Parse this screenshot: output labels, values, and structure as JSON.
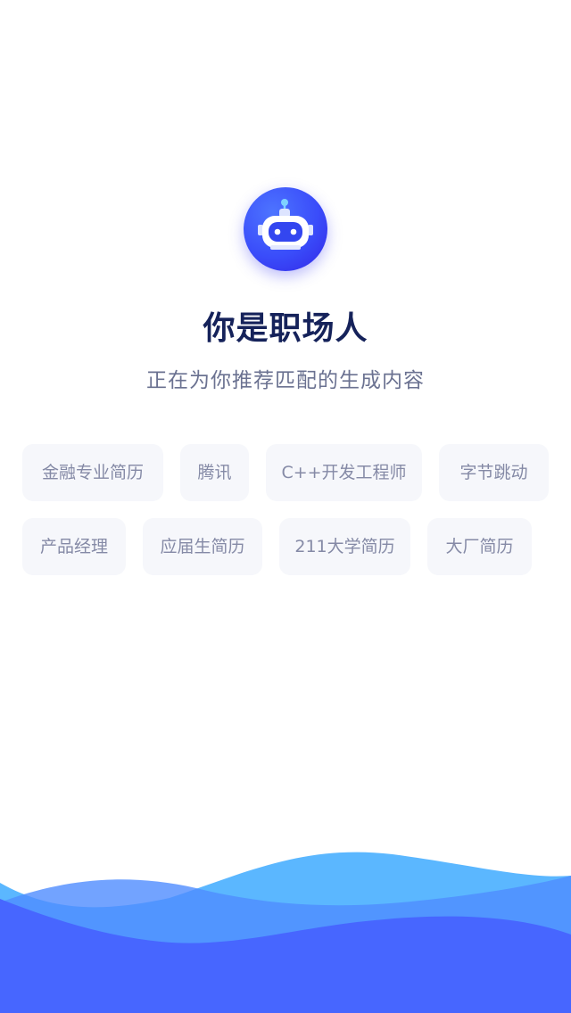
{
  "header": {
    "title": "你是职场人",
    "subtitle": "正在为你推荐匹配的生成内容"
  },
  "avatar": {
    "icon": "robot-icon"
  },
  "tags": {
    "row1": [
      "金融专业简历",
      "腾讯",
      "C++开发工程师",
      "字节跳动"
    ],
    "row2": [
      "产品经理",
      "应届生简历",
      "211大学简历",
      "大厂简历"
    ]
  },
  "colors": {
    "accent": "#3a4dfa",
    "title": "#15225a",
    "subtitle": "#6b7291",
    "tag_bg": "#f6f7fb",
    "tag_text": "#858aa6",
    "wave_light": "#5bb7ff",
    "wave_dark": "#4766ff"
  }
}
